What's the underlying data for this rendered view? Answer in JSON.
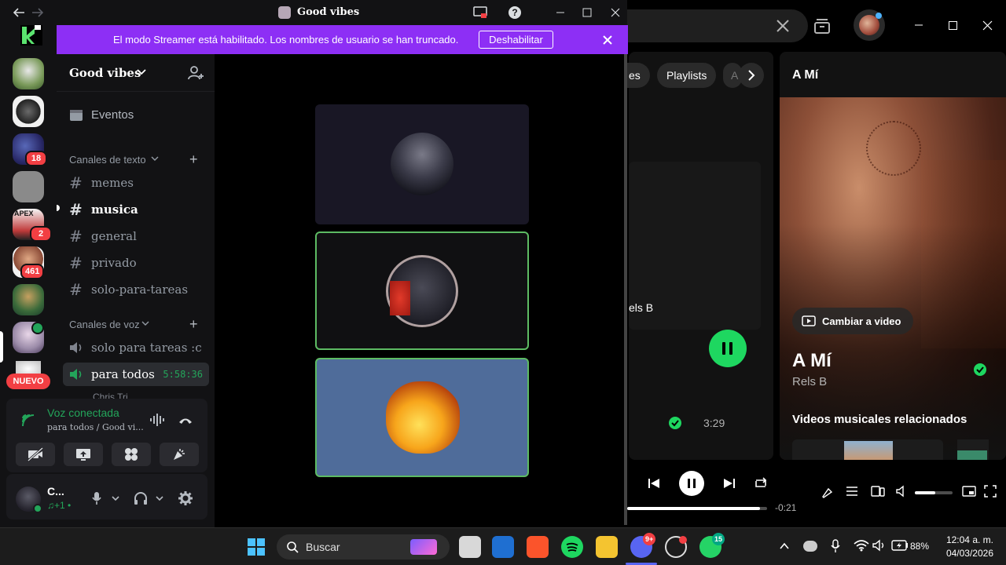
{
  "discord": {
    "window_title": "Good vibes",
    "banner": {
      "text": "El modo Streamer está habilitado. Los nombres de usuario se han truncado.",
      "button": "Deshabilitar"
    },
    "server_name": "Good vibes",
    "events_label": "Eventos",
    "text_category": "Canales de texto",
    "text_channels": [
      "memes",
      "musica",
      "general",
      "privado",
      "solo-para-tareas"
    ],
    "voice_category": "Canales de voz",
    "voice_channels": [
      {
        "name": "solo para tareas :c",
        "time": ""
      },
      {
        "name": "para todos",
        "time": "5:58:36"
      }
    ],
    "voice_member_partial": "Chris Tri",
    "badges": [
      "18",
      "2",
      "461"
    ],
    "new_label": "NUEVO",
    "voice_status": {
      "title": "Voz conectada",
      "subtitle": "para todos / Good vi..."
    },
    "user": {
      "name": "C...",
      "status": "♫+1 •"
    }
  },
  "spotify": {
    "chips": [
      "es",
      "Playlists",
      "A"
    ],
    "now_playing_header": "A Mí",
    "artist_partial": "els B",
    "track_duration": "3:29",
    "switch_video_label": "Cambiar a video",
    "song_title": "A Mí",
    "artist": "Rels B",
    "related_header": "Videos musicales relacionados",
    "remaining_time": "-0:21",
    "progress": 0.95,
    "volume": 0.55
  },
  "taskbar": {
    "search_placeholder": "Buscar",
    "battery": "88%",
    "time": "12:04 a. m.",
    "date": "04/03/2026",
    "discord_badge": "9+",
    "whatsapp_badge": "15"
  },
  "colors": {
    "discord_banner": "#8d2ff5",
    "spotify_green": "#1ed760",
    "voice_green": "#23a55a"
  }
}
